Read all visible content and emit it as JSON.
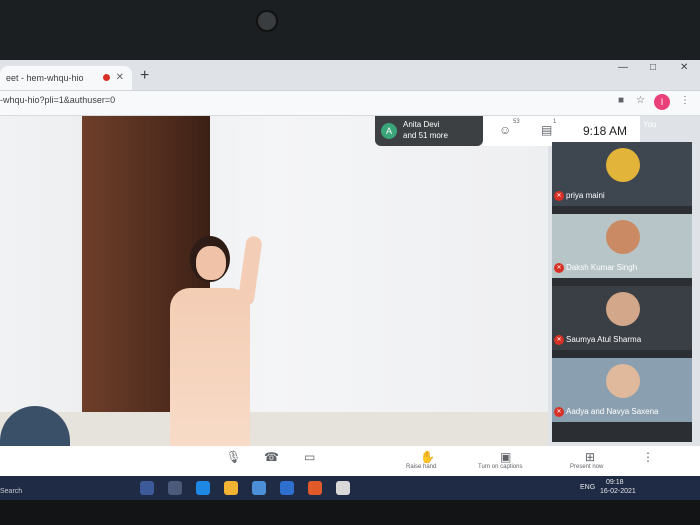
{
  "browser": {
    "tab_title": "eet - hem-whqu-hio",
    "new_tab": "+",
    "url": "-whqu-hio?pli=1&authuser=0",
    "profile_initial": "I"
  },
  "meet": {
    "participants_chip": {
      "initial": "A",
      "line1": "Anita Devi",
      "line2": "and 51 more"
    },
    "people_count": "53",
    "chat_badge": "1",
    "clock": "9:18 AM",
    "self_label": "You",
    "tiles": [
      {
        "name": "priya maini"
      },
      {
        "name": "Daksh Kumar Singh"
      },
      {
        "name": "Saumya Atul Sharma"
      },
      {
        "name": "Aadya and Navya Saxena"
      }
    ],
    "controls": {
      "raise_hand": "Raise hand",
      "captions": "Turn on captions",
      "present": "Present now"
    }
  },
  "taskbar": {
    "search_label": "Search",
    "lang": "ENG",
    "time": "09:18",
    "date": "16-02-2021"
  },
  "colors": {
    "accent_red": "#d93025",
    "taskbar": "#1f2a44",
    "chip": "#3c4043"
  }
}
